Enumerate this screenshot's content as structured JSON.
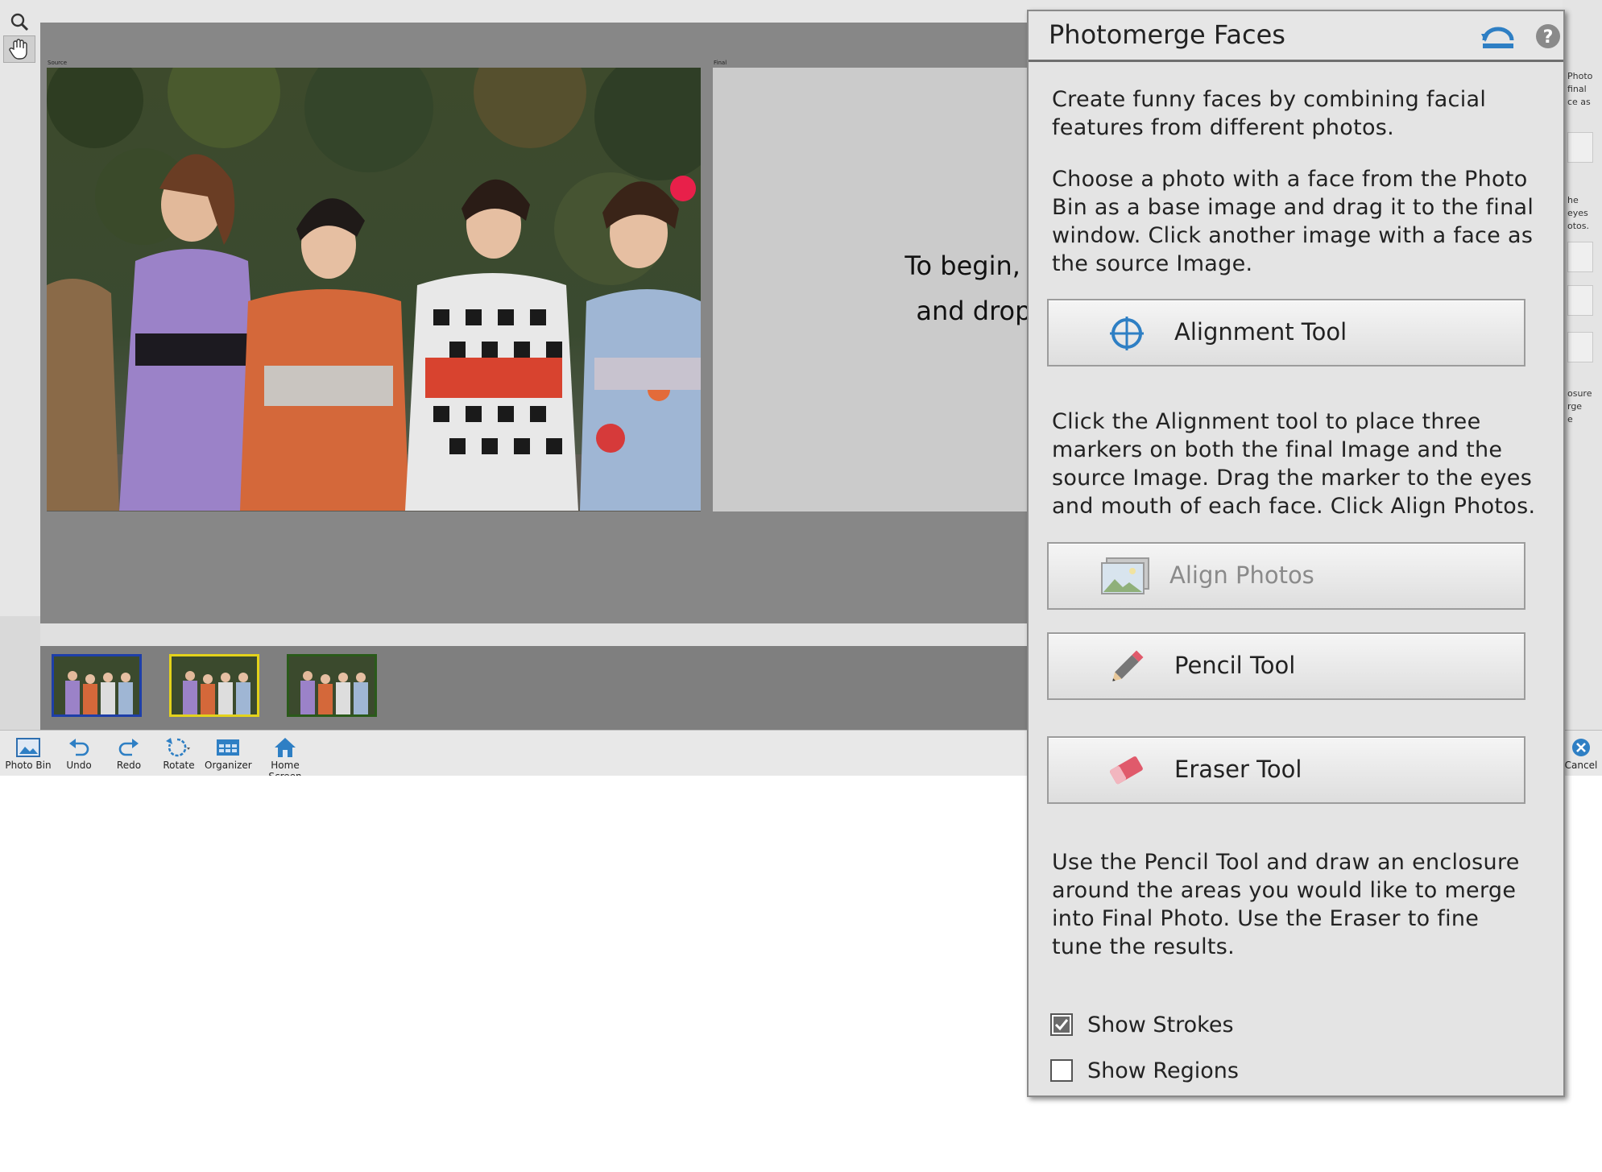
{
  "workspace": {
    "source_label": "Source",
    "final_label": "Final",
    "final_instructions": [
      "To begin, drag a pho",
      "and drop it here to"
    ]
  },
  "bottom_toolbar": {
    "photo_bin": "Photo Bin",
    "undo": "Undo",
    "redo": "Redo",
    "rotate": "Rotate",
    "organizer": "Organizer",
    "home_screen": "Home Screen",
    "cancel": "Cancel"
  },
  "right_strip_fragments": [
    "Photo",
    "final",
    "ce as",
    "he",
    "eyes",
    "otos.",
    "osure",
    "rge",
    "e"
  ],
  "panel": {
    "title": "Photomerge Faces",
    "intro_1": [
      "Create funny faces by combining facial",
      "features from different photos."
    ],
    "intro_2": [
      "Choose a photo with a face from the Photo",
      "Bin as a base image and drag it to the final",
      "window. Click another image with a face as",
      "the source Image."
    ],
    "alignment_tool_label": "Alignment Tool",
    "alignment_help": [
      "Click the Alignment tool to place three",
      "markers on both the final Image and the",
      "source Image. Drag the marker to the eyes",
      "and mouth of each face. Click Align Photos."
    ],
    "align_photos_label": "Align Photos",
    "pencil_tool_label": "Pencil Tool",
    "eraser_tool_label": "Eraser Tool",
    "pencil_help": [
      "Use the Pencil Tool and draw an enclosure",
      "around the areas you would like to merge",
      "into Final Photo. Use the Eraser to fine",
      "tune the results."
    ],
    "show_strokes_label": "Show Strokes",
    "show_strokes_checked": true,
    "show_regions_label": "Show Regions",
    "show_regions_checked": false
  },
  "thumbnails": [
    {
      "name": "photo-1",
      "border_color": "#1e3fa8"
    },
    {
      "name": "photo-2",
      "border_color": "#e3d21b"
    },
    {
      "name": "photo-3",
      "border_color": "#2a5a1a"
    }
  ],
  "colors": {
    "accent_blue": "#2e7fc4",
    "eraser_pink": "#e05a6b"
  }
}
